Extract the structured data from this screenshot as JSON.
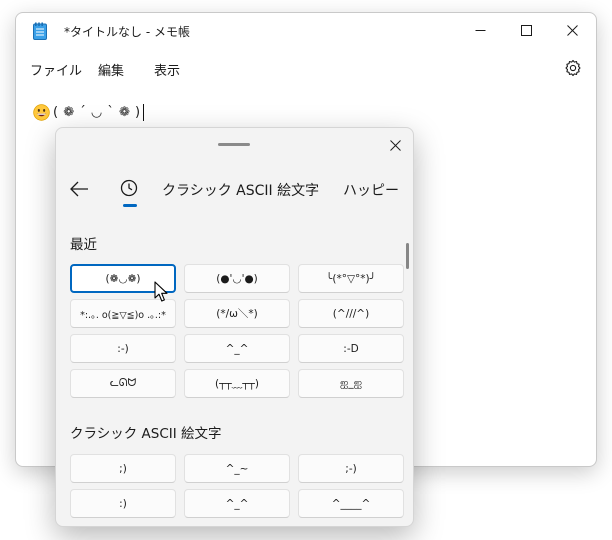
{
  "notepad": {
    "title": "*タイトルなし - メモ帳",
    "menu": {
      "file": "ファイル",
      "edit": "編集",
      "view": "表示"
    },
    "editor_text": "( ❁ ´ ◡ ` ❁ )"
  },
  "emoji_panel": {
    "tabs": {
      "classic": "クラシック ASCII 絵文字",
      "happy": "ハッピー"
    },
    "recent": {
      "heading": "最近",
      "items": [
        "(❁◡❁)",
        "(●'◡'●)",
        "╰(*°▽°*)╯",
        "*:.｡. o(≧▽≦)o .｡.:*",
        "(*/ω＼*)",
        "(^///^)",
        ":-)",
        "^_^",
        ":-D",
        "ᓚᘏᗢ",
        "(┬┬﹏┬┬)",
        "ஐ_ஐ"
      ]
    },
    "classic": {
      "heading": "クラシック ASCII 絵文字",
      "items": [
        ";)",
        "^_~",
        ";-)",
        ":)",
        "^_^",
        "^____^"
      ]
    }
  },
  "colors": {
    "accent": "#0067c0",
    "panel_bg": "#f3f3f3",
    "tile_bg": "#fbfbfb"
  }
}
